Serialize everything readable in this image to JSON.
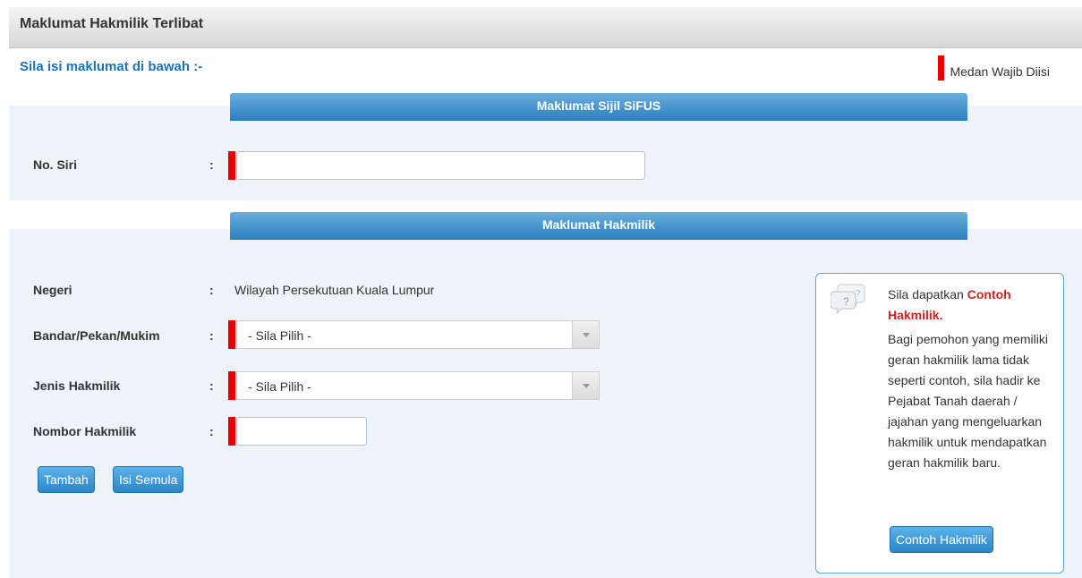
{
  "page": {
    "title": "Maklumat Hakmilik Terlibat",
    "instruction": "Sila isi maklumat di bawah :-",
    "required_legend": "Medan Wajib Diisi"
  },
  "colors": {
    "accent": "#2b86c8",
    "required": "#e60000",
    "highlight": "#d62020"
  },
  "sifus": {
    "header": "Maklumat Sijil SiFUS",
    "no_siri_label": "No. Siri",
    "no_siri_value": ""
  },
  "hakmilik": {
    "header": "Maklumat Hakmilik",
    "negeri_label": "Negeri",
    "negeri_value": "Wilayah Persekutuan Kuala Lumpur",
    "bandar_label": "Bandar/Pekan/Mukim",
    "bandar_selected": "- Sila Pilih -",
    "jenis_label": "Jenis Hakmilik",
    "jenis_selected": "- Sila Pilih -",
    "nombor_label": "Nombor Hakmilik",
    "nombor_value": "",
    "separator": ":"
  },
  "buttons": {
    "tambah": "Tambah",
    "isi_semula": "Isi Semula"
  },
  "help": {
    "icon": "question-bubble-icon",
    "intro": "Sila dapatkan ",
    "highlight_a": "Contoh",
    "highlight_b": "Hakmilik.",
    "body": "Bagi pemohon yang memiliki geran hakmilik lama tidak seperti contoh, sila hadir ke Pejabat Tanah daerah / jajahan yang mengeluarkan hakmilik untuk mendapatkan geran hakmilik baru.",
    "button": "Contoh Hakmilik"
  }
}
